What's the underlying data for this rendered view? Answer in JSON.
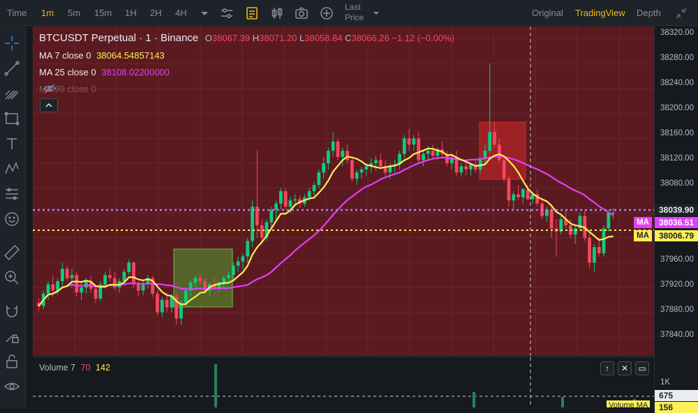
{
  "toolbar": {
    "time_label": "Time",
    "timeframes": [
      "1m",
      "5m",
      "15m",
      "1H",
      "2H",
      "4H"
    ],
    "active_timeframe": "1m",
    "last_price_line1": "Last",
    "last_price_line2": "Price",
    "views": [
      "Original",
      "TradingView",
      "Depth"
    ],
    "active_view": "TradingView"
  },
  "legend": {
    "symbol": "BTCUSDT Perpetual · 1 · Binance",
    "o_label": "O",
    "o_value": "38067.39",
    "h_label": "H",
    "h_value": "38071.20",
    "l_label": "L",
    "l_value": "38058.84",
    "c_label": "C",
    "c_value": "38066.26",
    "change": "−1.12 (−0.00%)",
    "ma7_label": "MA 7 close 0",
    "ma7_value": "38064.54857143",
    "ma25_label": "MA 25 close 0",
    "ma25_value": "38108.02200000",
    "ma99_label": "MA 99 close 0"
  },
  "axis": {
    "ticks": [
      "38320.00",
      "38280.00",
      "38240.00",
      "38200.00",
      "38160.00",
      "38120.00",
      "38080.00",
      "37960.00",
      "37920.00",
      "37880.00",
      "37840.00"
    ],
    "last_price": "38039.90",
    "ma25_tag_label": "MA",
    "ma25_tag_value": "38036.51",
    "ma7_tag_label": "MA",
    "ma7_tag_value": "38006.79",
    "vol_tick": "1K",
    "vol_value": "675",
    "vol_ma_value": "156",
    "vol_ma_label": "Volume MA"
  },
  "volume": {
    "label": "Volume 7",
    "v1": "70",
    "v2": "142"
  },
  "colors": {
    "up": "#0ecb81",
    "down": "#f6465d",
    "ma7": "#fcef58",
    "ma25": "#e040fb",
    "accent": "#f0b90b"
  },
  "chart_data": {
    "type": "candlestick",
    "symbol": "BTCUSDT Perpetual",
    "interval": "1m",
    "ylim": [
      37810,
      38340
    ],
    "ohlc": [
      [
        37895,
        37902,
        37882,
        37890
      ],
      [
        37890,
        37915,
        37885,
        37910
      ],
      [
        37910,
        37930,
        37900,
        37925
      ],
      [
        37925,
        37940,
        37905,
        37915
      ],
      [
        37915,
        37935,
        37908,
        37930
      ],
      [
        37930,
        37960,
        37920,
        37950
      ],
      [
        37950,
        37955,
        37930,
        37935
      ],
      [
        37935,
        37950,
        37920,
        37940
      ],
      [
        37940,
        37945,
        37905,
        37912
      ],
      [
        37912,
        37928,
        37900,
        37920
      ],
      [
        37920,
        37935,
        37910,
        37930
      ],
      [
        37930,
        37938,
        37912,
        37918
      ],
      [
        37918,
        37925,
        37895,
        37902
      ],
      [
        37902,
        37930,
        37898,
        37925
      ],
      [
        37925,
        37945,
        37918,
        37940
      ],
      [
        37940,
        37950,
        37930,
        37935
      ],
      [
        37935,
        37945,
        37915,
        37920
      ],
      [
        37920,
        37935,
        37912,
        37930
      ],
      [
        37930,
        37950,
        37925,
        37945
      ],
      [
        37945,
        37965,
        37940,
        37960
      ],
      [
        37960,
        37962,
        37920,
        37925
      ],
      [
        37925,
        37930,
        37905,
        37915
      ],
      [
        37915,
        37930,
        37908,
        37925
      ],
      [
        37925,
        37940,
        37918,
        37935
      ],
      [
        37935,
        37938,
        37905,
        37910
      ],
      [
        37910,
        37915,
        37875,
        37880
      ],
      [
        37880,
        37905,
        37872,
        37900
      ],
      [
        37900,
        37912,
        37880,
        37888
      ],
      [
        37888,
        37910,
        37880,
        37905
      ],
      [
        37905,
        37912,
        37860,
        37870
      ],
      [
        37870,
        37900,
        37860,
        37895
      ],
      [
        37895,
        37920,
        37890,
        37915
      ],
      [
        37915,
        37932,
        37905,
        37928
      ],
      [
        37928,
        37940,
        37920,
        37935
      ],
      [
        37935,
        37942,
        37925,
        37930
      ],
      [
        37930,
        37935,
        37910,
        37915
      ],
      [
        37915,
        37928,
        37905,
        37925
      ],
      [
        37925,
        37935,
        37915,
        37920
      ],
      [
        37920,
        37930,
        37912,
        37928
      ],
      [
        37928,
        37940,
        37920,
        37935
      ],
      [
        37935,
        37945,
        37925,
        37940
      ],
      [
        37940,
        37960,
        37930,
        37955
      ],
      [
        37955,
        37970,
        37945,
        37962
      ],
      [
        37962,
        37975,
        37950,
        37970
      ],
      [
        37970,
        38000,
        37960,
        37995
      ],
      [
        37995,
        38060,
        37985,
        38050
      ],
      [
        38050,
        38140,
        38000,
        38020
      ],
      [
        38020,
        38030,
        37990,
        38000
      ],
      [
        38000,
        38030,
        37995,
        38025
      ],
      [
        38025,
        38050,
        38015,
        38045
      ],
      [
        38045,
        38060,
        38030,
        38055
      ],
      [
        38055,
        38080,
        38045,
        38075
      ],
      [
        38075,
        38080,
        38045,
        38050
      ],
      [
        38050,
        38065,
        38040,
        38060
      ],
      [
        38060,
        38070,
        38050,
        38062
      ],
      [
        38062,
        38068,
        38048,
        38055
      ],
      [
        38055,
        38070,
        38050,
        38065
      ],
      [
        38065,
        38080,
        38060,
        38075
      ],
      [
        38075,
        38090,
        38068,
        38085
      ],
      [
        38085,
        38110,
        38080,
        38105
      ],
      [
        38105,
        38130,
        38095,
        38120
      ],
      [
        38120,
        38145,
        38110,
        38140
      ],
      [
        38140,
        38170,
        38130,
        38155
      ],
      [
        38155,
        38160,
        38125,
        38130
      ],
      [
        38130,
        38145,
        38115,
        38140
      ],
      [
        38140,
        38150,
        38120,
        38125
      ],
      [
        38125,
        38130,
        38090,
        38095
      ],
      [
        38095,
        38110,
        38085,
        38105
      ],
      [
        38105,
        38115,
        38095,
        38110
      ],
      [
        38110,
        38120,
        38100,
        38115
      ],
      [
        38115,
        38128,
        38105,
        38120
      ],
      [
        38120,
        38132,
        38108,
        38125
      ],
      [
        38125,
        38135,
        38110,
        38115
      ],
      [
        38115,
        38125,
        38100,
        38105
      ],
      [
        38105,
        38120,
        38095,
        38115
      ],
      [
        38115,
        38125,
        38105,
        38118
      ],
      [
        38118,
        38140,
        38110,
        38135
      ],
      [
        38135,
        38165,
        38128,
        38160
      ],
      [
        38160,
        38175,
        38140,
        38150
      ],
      [
        38150,
        38165,
        38140,
        38160
      ],
      [
        38160,
        38170,
        38120,
        38125
      ],
      [
        38125,
        38140,
        38115,
        38135
      ],
      [
        38135,
        38148,
        38125,
        38140
      ],
      [
        38140,
        38150,
        38128,
        38132
      ],
      [
        38132,
        38145,
        38125,
        38142
      ],
      [
        38142,
        38155,
        38130,
        38135
      ],
      [
        38135,
        38140,
        38115,
        38120
      ],
      [
        38120,
        38135,
        38110,
        38130
      ],
      [
        38130,
        38140,
        38100,
        38105
      ],
      [
        38105,
        38120,
        38098,
        38115
      ],
      [
        38115,
        38125,
        38100,
        38110
      ],
      [
        38110,
        38120,
        38100,
        38118
      ],
      [
        38118,
        38125,
        38105,
        38110
      ],
      [
        38110,
        38130,
        38105,
        38128
      ],
      [
        38128,
        38150,
        38120,
        38140
      ],
      [
        38140,
        38280,
        38135,
        38170
      ],
      [
        38170,
        38185,
        38145,
        38150
      ],
      [
        38150,
        38160,
        38120,
        38125
      ],
      [
        38125,
        38130,
        38090,
        38095
      ],
      [
        38095,
        38100,
        38050,
        38060
      ],
      [
        38060,
        38075,
        38045,
        38070
      ],
      [
        38070,
        38085,
        38060,
        38065
      ],
      [
        38065,
        38080,
        38055,
        38078
      ],
      [
        38078,
        38085,
        38060,
        38062
      ],
      [
        38062,
        38075,
        38055,
        38070
      ],
      [
        38070,
        38078,
        38050,
        38055
      ],
      [
        38055,
        38062,
        38030,
        38035
      ],
      [
        38035,
        38050,
        38025,
        38045
      ],
      [
        38045,
        38055,
        38000,
        38015
      ],
      [
        38015,
        38030,
        37970,
        38010
      ],
      [
        38010,
        38035,
        38005,
        38030
      ],
      [
        38030,
        38045,
        38015,
        38020
      ],
      [
        38020,
        38030,
        38000,
        38005
      ],
      [
        38005,
        38020,
        37990,
        38015
      ],
      [
        38015,
        38040,
        38010,
        38035
      ],
      [
        38035,
        38045,
        37995,
        38000
      ],
      [
        38000,
        38010,
        37950,
        37960
      ],
      [
        37960,
        37990,
        37945,
        37985
      ],
      [
        37985,
        38000,
        37970,
        37975
      ],
      [
        37975,
        38020,
        37970,
        38015
      ],
      [
        38015,
        38045,
        38010,
        38040
      ],
      [
        38040,
        38048,
        38030,
        38040
      ]
    ],
    "ma7_last": 38064.54857143,
    "ma25_last": 38108.022,
    "last_price": 38039.9,
    "volume": [
      70,
      142,
      675
    ]
  }
}
